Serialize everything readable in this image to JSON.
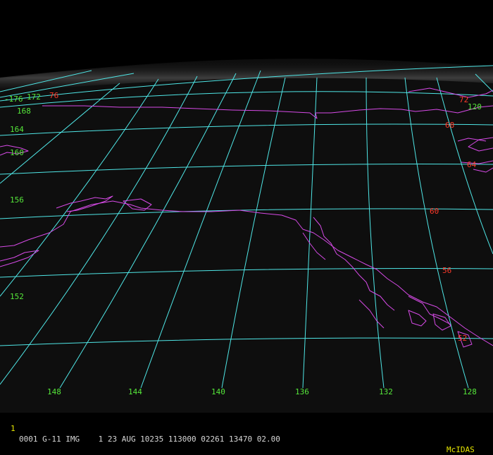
{
  "colors": {
    "background": "#000000",
    "grid": "#4fe6e6",
    "coastline": "#d64ae6",
    "lat_label": "#ff3a2a",
    "lon_label": "#55e63a",
    "status_text": "#d8d8d8",
    "status_brand": "#e6e600"
  },
  "map": {
    "latitude_labels": [
      "76",
      "72",
      "68",
      "64",
      "60",
      "56",
      "52"
    ],
    "longitude_labels_left": [
      "-176",
      "172",
      "168",
      "164",
      "160",
      "156",
      "152"
    ],
    "longitude_labels_bottom": [
      "148",
      "144",
      "140",
      "136",
      "132",
      "128"
    ],
    "right_edge_label": "120"
  },
  "status_bar": {
    "frame": "1",
    "text": "0001 G-11 IMG    1 23 AUG 10235 113000 02261 13470 02.00",
    "brand": "McIDAS"
  }
}
